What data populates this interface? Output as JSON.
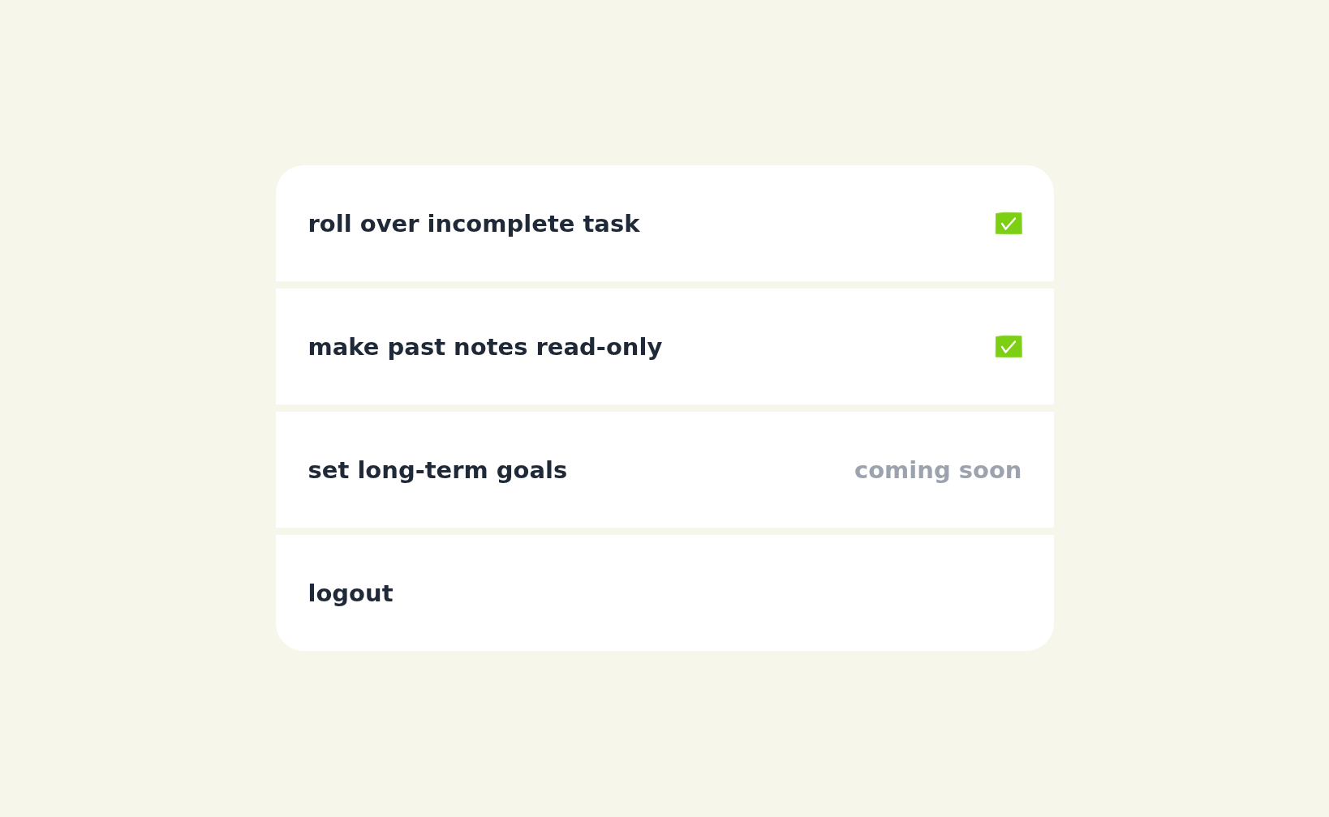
{
  "settings": [
    {
      "kind": "checkbox",
      "label": "roll over incomplete task",
      "checked": true
    },
    {
      "kind": "checkbox",
      "label": "make past notes read-only",
      "checked": true
    },
    {
      "kind": "status",
      "label": "set long-term goals",
      "status": "coming soon"
    },
    {
      "kind": "action",
      "label": "logout"
    }
  ]
}
